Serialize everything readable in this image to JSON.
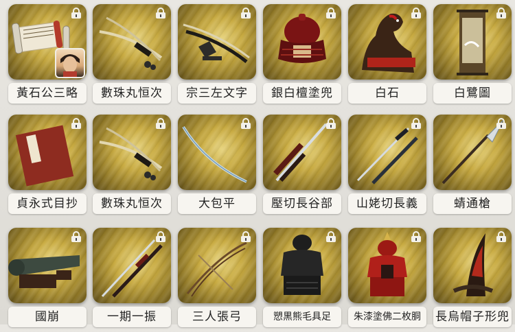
{
  "items": [
    {
      "name": "黃石公三略",
      "icon": "scroll-icon",
      "avatar": true
    },
    {
      "name": "數珠丸恒次",
      "icon": "crossed-swords-icon"
    },
    {
      "name": "宗三左文字",
      "icon": "sword-on-stand-icon"
    },
    {
      "name": "銀白檀塗兜",
      "icon": "kabuto-helmet-icon"
    },
    {
      "name": "白石",
      "icon": "warhorse-icon"
    },
    {
      "name": "白鷺圖",
      "icon": "hanging-scroll-icon"
    },
    {
      "name": "貞永式目抄",
      "icon": "book-icon"
    },
    {
      "name": "數珠丸恒次",
      "icon": "crossed-swords-icon"
    },
    {
      "name": "大包平",
      "icon": "tachi-sword-icon"
    },
    {
      "name": "壓切長谷部",
      "icon": "katana-icon"
    },
    {
      "name": "山姥切長義",
      "icon": "crossed-katanas-icon"
    },
    {
      "name": "蜻通槍",
      "icon": "spear-icon"
    },
    {
      "name": "國崩",
      "icon": "cannon-icon"
    },
    {
      "name": "一期一振",
      "icon": "crossed-katanas-icon"
    },
    {
      "name": "三人張弓",
      "icon": "bow-icon"
    },
    {
      "name": "愬黒熊毛具足",
      "icon": "black-armor-icon"
    },
    {
      "name": "朱漆塗佛二枚胴",
      "icon": "red-armor-icon"
    },
    {
      "name": "長烏帽子形兜",
      "icon": "tall-helmet-icon"
    }
  ]
}
